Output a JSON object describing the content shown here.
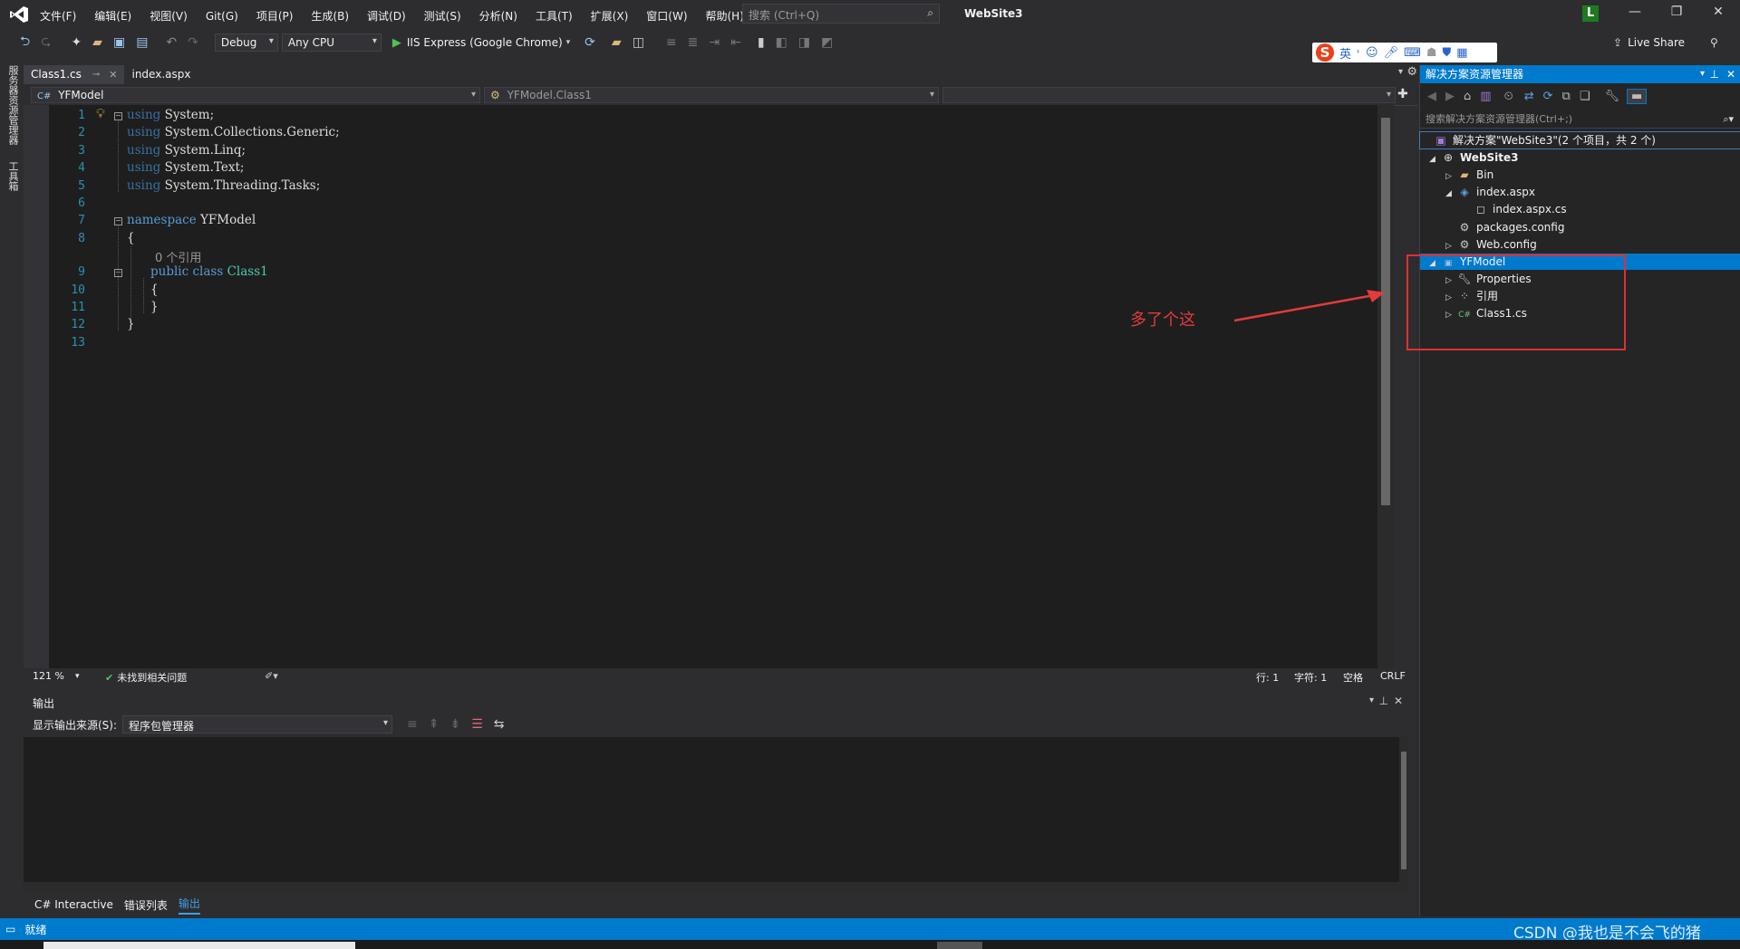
{
  "menu": [
    "文件(F)",
    "编辑(E)",
    "视图(V)",
    "Git(G)",
    "项目(P)",
    "生成(B)",
    "调试(D)",
    "测试(S)",
    "分析(N)",
    "工具(T)",
    "扩展(X)",
    "窗口(W)",
    "帮助(H)"
  ],
  "search": {
    "placeholder": "搜索 (Ctrl+Q)"
  },
  "solution_name": "WebSite3",
  "avatar_letter": "L",
  "toolbar": {
    "config": "Debug",
    "platform": "Any CPU",
    "run_target": "IIS Express (Google Chrome)",
    "live_share": "Live Share"
  },
  "ime": {
    "lang": "英"
  },
  "left_strip": [
    "服务器资源管理器",
    "工具箱"
  ],
  "doc_tabs": [
    "Class1.cs",
    "index.aspx"
  ],
  "nav": {
    "project": "YFModel",
    "class": "YFModel.Class1"
  },
  "code_lines": [
    {
      "n": "1",
      "text": "using System;"
    },
    {
      "n": "2",
      "text": "using System.Collections.Generic;"
    },
    {
      "n": "3",
      "text": "using System.Linq;"
    },
    {
      "n": "4",
      "text": "using System.Text;"
    },
    {
      "n": "5",
      "text": "using System.Threading.Tasks;"
    },
    {
      "n": "6",
      "text": ""
    },
    {
      "n": "7",
      "text": "namespace YFModel"
    },
    {
      "n": "8",
      "text": "{"
    },
    {
      "n": "9",
      "text": "public class Class1"
    },
    {
      "n": "10",
      "text": "{"
    },
    {
      "n": "11",
      "text": "}"
    },
    {
      "n": "12",
      "text": "}"
    },
    {
      "n": "13",
      "text": ""
    }
  ],
  "code_lens": "0 个引用",
  "editor_status": {
    "zoom": "121 %",
    "issues": "未找到相关问题",
    "line": "行: 1",
    "char": "字符: 1",
    "spaces": "空格",
    "eol": "CRLF"
  },
  "annotation": "多了个这",
  "output": {
    "title": "输出",
    "source_label": "显示输出来源(S):",
    "source_value": "程序包管理器"
  },
  "bottom_tabs": [
    "C# Interactive",
    "错误列表",
    "输出"
  ],
  "statusbar": {
    "text": "就绪"
  },
  "watermark": "CSDN @我也是不会飞的猪",
  "solution_explorer": {
    "title": "解决方案资源管理器",
    "search_placeholder": "搜索解决方案资源管理器(Ctrl+;)",
    "tree": [
      {
        "label": "解决方案\"WebSite3\"(2 个项目，共 2 个)",
        "depth": 0,
        "arrow": "",
        "icon": "solution-icon",
        "bold": false,
        "selected": false
      },
      {
        "label": "WebSite3",
        "depth": 0,
        "arrow": "expanded",
        "icon": "globe-icon",
        "bold": true,
        "selected": false
      },
      {
        "label": "Bin",
        "depth": 1,
        "arrow": "collapsed",
        "icon": "folder-icon",
        "bold": false,
        "selected": false
      },
      {
        "label": "index.aspx",
        "depth": 1,
        "arrow": "expanded",
        "icon": "aspx-file-icon",
        "bold": false,
        "selected": false
      },
      {
        "label": "index.aspx.cs",
        "depth": 2,
        "arrow": "",
        "icon": "cs-file-icon",
        "bold": false,
        "selected": false
      },
      {
        "label": "packages.config",
        "depth": 1,
        "arrow": "",
        "icon": "config-file-icon",
        "bold": false,
        "selected": false
      },
      {
        "label": "Web.config",
        "depth": 1,
        "arrow": "collapsed",
        "icon": "config-file-icon",
        "bold": false,
        "selected": false
      },
      {
        "label": "YFModel",
        "depth": 0,
        "arrow": "expanded",
        "icon": "csharp-project-icon",
        "bold": false,
        "selected": true
      },
      {
        "label": "Properties",
        "depth": 1,
        "arrow": "collapsed",
        "icon": "wrench-icon",
        "bold": false,
        "selected": false
      },
      {
        "label": "引用",
        "depth": 1,
        "arrow": "collapsed",
        "icon": "references-icon",
        "bold": false,
        "selected": false
      },
      {
        "label": "Class1.cs",
        "depth": 1,
        "arrow": "collapsed",
        "icon": "csharp-class-icon",
        "bold": false,
        "selected": false
      }
    ]
  },
  "colors": {
    "accent": "#007acc",
    "annotation": "#e33b3b",
    "keyword": "#569cd6",
    "type": "#4ec9b0",
    "line_number": "#2b91af"
  }
}
